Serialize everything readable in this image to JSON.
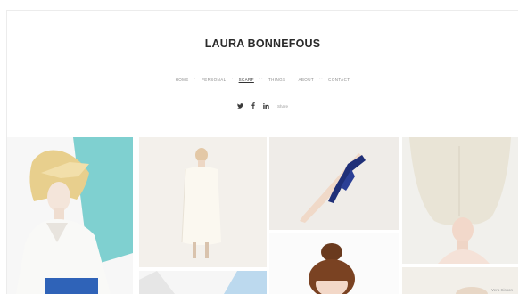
{
  "site": {
    "title": "LAURA BONNEFOUS"
  },
  "nav": {
    "items": [
      {
        "label": "HOME",
        "active": false
      },
      {
        "label": "PERSONAL",
        "active": false
      },
      {
        "label": "SCARF",
        "active": true
      },
      {
        "label": "THINGS",
        "active": false
      },
      {
        "label": "ABOUT",
        "active": false
      },
      {
        "label": "CONTACT",
        "active": false
      }
    ]
  },
  "social": {
    "twitter_icon": "twitter-icon",
    "facebook_icon": "facebook-icon",
    "linkedin_icon": "linkedin-icon",
    "share_label": "Share"
  },
  "gallery": {
    "credit": "Vera Sisson",
    "accent_teal": "#7fd0d0",
    "accent_blue": "#2d4fa3",
    "photo_bg": "#f3f1ee"
  }
}
